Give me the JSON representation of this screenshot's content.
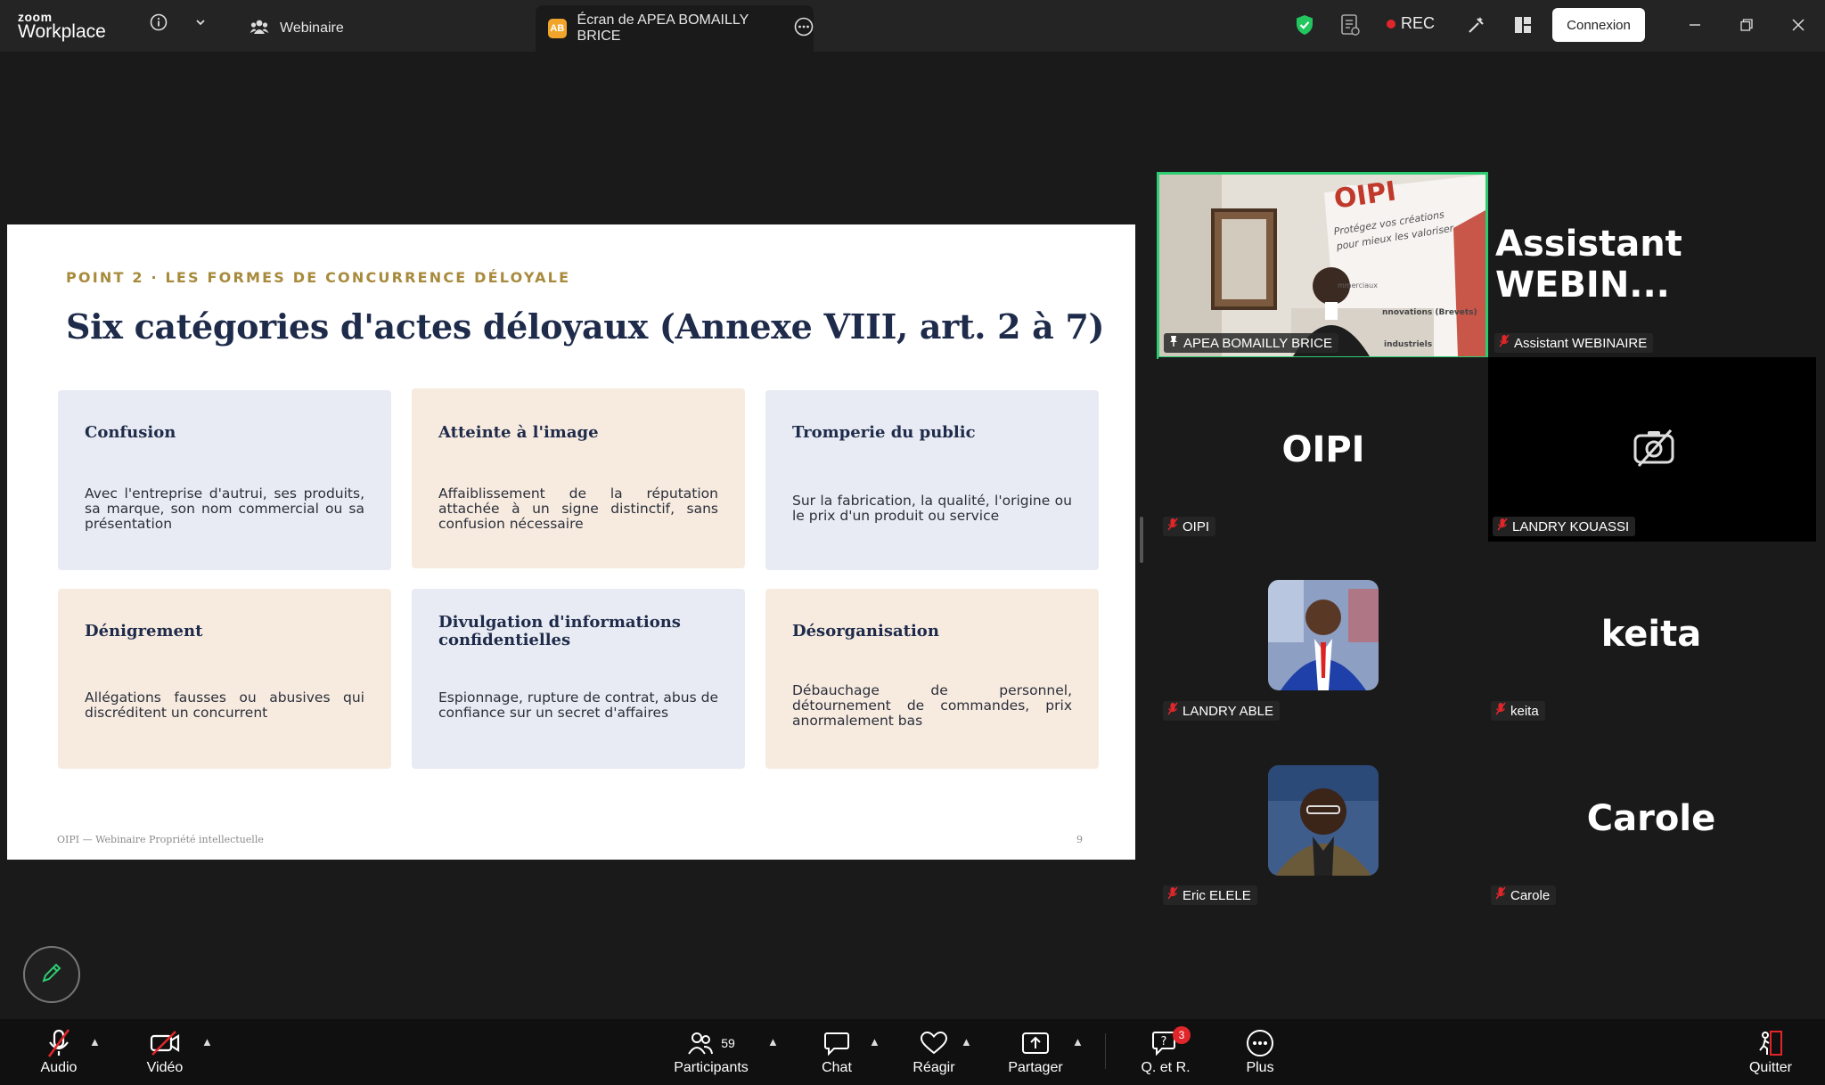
{
  "app": {
    "logo_line1": "zoom",
    "logo_line2": "Workplace"
  },
  "tabs": {
    "webinar_label": "Webinaire",
    "share_avatar": "AB",
    "share_label": "Écran de APEA  BOMAILLY BRICE"
  },
  "topbar": {
    "rec_label": "REC",
    "connexion_label": "Connexion",
    "colors": {
      "shield": "#22c55e",
      "rec": "#e0262a"
    }
  },
  "slide": {
    "eyebrow": "POINT 2 · LES FORMES DE CONCURRENCE DÉLOYALE",
    "title": "Six catégories d'actes déloyaux (Annexe VIII, art. 2 à 7)",
    "cards": [
      {
        "title": "Confusion",
        "text": "Avec l'entreprise d'autrui, ses produits, sa marque, son nom commercial ou sa présentation"
      },
      {
        "title": "Atteinte à l'image",
        "text": "Affaiblissement de la réputation attachée à un signe distinctif, sans confusion nécessaire"
      },
      {
        "title": "Tromperie du public",
        "text": "Sur la fabrication, la qualité, l'origine ou le prix d'un produit ou service"
      },
      {
        "title": "Dénigrement",
        "text": "Allégations fausses ou abusives qui discréditent un concurrent"
      },
      {
        "title": "Divulgation d'informations confidentielles",
        "text": "Espionnage, rupture de contrat, abus de confiance sur un secret d'affaires"
      },
      {
        "title": "Désorganisation",
        "text": "Débauchage de personnel, détournement de commandes, prix anormalement bas"
      }
    ],
    "footer": "OIPI — Webinaire Propriété intellectuelle",
    "page_number": "9",
    "colors": {
      "eyebrow": "#a88a3c",
      "title": "#1e2b4a",
      "card_blue": "#e8ebf3",
      "card_beige": "#f7ebe0"
    }
  },
  "participants_grid": {
    "active": {
      "name": "APEA  BOMAILLY BRICE",
      "banner_brand": "OIPI",
      "banner_line1": "Protégez vos créations",
      "banner_line2": "pour mieux les valoriser",
      "banner_line3": "nnovations (Brevets)",
      "banner_line4": "industriels",
      "banner_line5": "mmerciaux"
    },
    "tiles": [
      {
        "display": "Assistant  WEBIN...",
        "name": "Assistant WEBINAIRE"
      },
      {
        "display": "OIPI",
        "name": "OIPI"
      },
      {
        "display": "",
        "name": "LANDRY KOUASSI"
      },
      {
        "display": "",
        "name": "LANDRY ABLE"
      },
      {
        "display": "keita",
        "name": "keita"
      },
      {
        "display": "",
        "name": "Eric ELELE"
      },
      {
        "display": "Carole",
        "name": "Carole"
      }
    ]
  },
  "toolbar": {
    "audio": "Audio",
    "video": "Vidéo",
    "participants": "Participants",
    "participants_count": "59",
    "chat": "Chat",
    "react": "Réagir",
    "share": "Partager",
    "qa": "Q. et R.",
    "qa_badge": "3",
    "more": "Plus",
    "leave": "Quitter"
  }
}
